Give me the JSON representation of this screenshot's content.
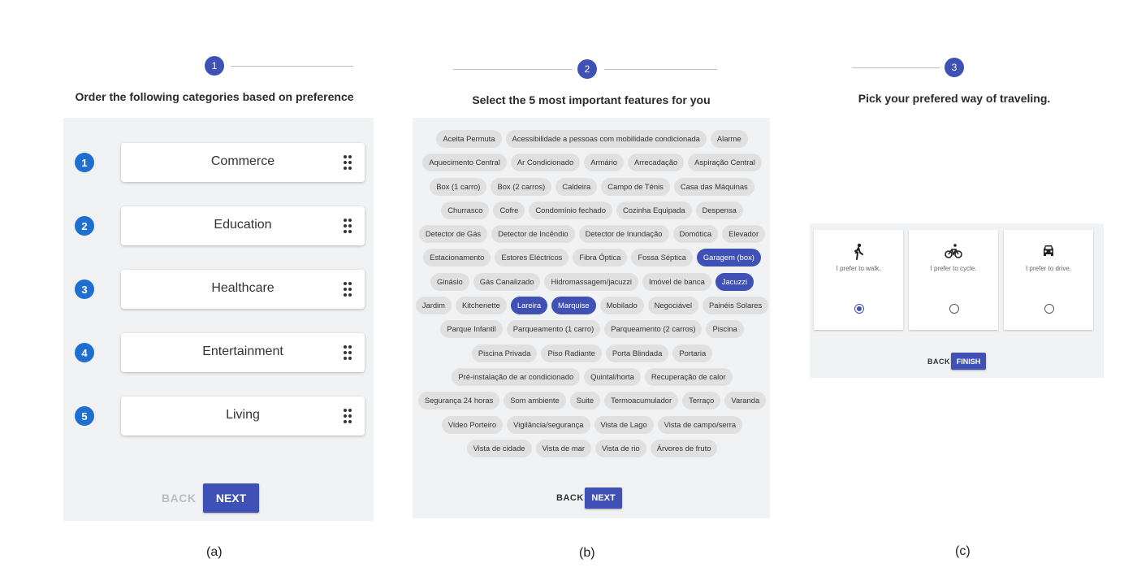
{
  "panel_a": {
    "step": "1",
    "heading": "Order the following categories based on preference",
    "categories": [
      {
        "rank": "1",
        "label": "Commerce"
      },
      {
        "rank": "2",
        "label": "Education"
      },
      {
        "rank": "3",
        "label": "Healthcare"
      },
      {
        "rank": "4",
        "label": "Entertainment"
      },
      {
        "rank": "5",
        "label": "Living"
      }
    ],
    "back_label": "BACK",
    "next_label": "NEXT"
  },
  "panel_b": {
    "step": "2",
    "heading": "Select the 5 most important features for you",
    "chip_rows": [
      [
        {
          "label": "Aceita Permuta",
          "selected": false
        },
        {
          "label": "Acessibilidade a pessoas com mobilidade condicionada",
          "selected": false
        },
        {
          "label": "Alarme",
          "selected": false
        }
      ],
      [
        {
          "label": "Aquecimento Central",
          "selected": false
        },
        {
          "label": "Ar Condicionado",
          "selected": false
        },
        {
          "label": "Armário",
          "selected": false
        },
        {
          "label": "Arrecadação",
          "selected": false
        },
        {
          "label": "Aspiração Central",
          "selected": false
        }
      ],
      [
        {
          "label": "Box (1 carro)",
          "selected": false
        },
        {
          "label": "Box (2 carros)",
          "selected": false
        },
        {
          "label": "Caldeira",
          "selected": false
        },
        {
          "label": "Campo de Ténis",
          "selected": false
        },
        {
          "label": "Casa das Máquinas",
          "selected": false
        }
      ],
      [
        {
          "label": "Churrasco",
          "selected": false
        },
        {
          "label": "Cofre",
          "selected": false
        },
        {
          "label": "Condomínio fechado",
          "selected": false
        },
        {
          "label": "Cozinha Equipada",
          "selected": false
        },
        {
          "label": "Despensa",
          "selected": false
        }
      ],
      [
        {
          "label": "Detector de Gás",
          "selected": false
        },
        {
          "label": "Detector de Incêndio",
          "selected": false
        },
        {
          "label": "Detector de Inundação",
          "selected": false
        },
        {
          "label": "Domótica",
          "selected": false
        },
        {
          "label": "Elevador",
          "selected": false
        }
      ],
      [
        {
          "label": "Estacionamento",
          "selected": false
        },
        {
          "label": "Estores Eléctricos",
          "selected": false
        },
        {
          "label": "Fibra Óptica",
          "selected": false
        },
        {
          "label": "Fossa Séptica",
          "selected": false
        },
        {
          "label": "Garagem (box)",
          "selected": true
        }
      ],
      [
        {
          "label": "Ginásio",
          "selected": false
        },
        {
          "label": "Gás Canalizado",
          "selected": false
        },
        {
          "label": "Hidromassagem/jacuzzi",
          "selected": false
        },
        {
          "label": "Imóvel de banca",
          "selected": false
        },
        {
          "label": "Jacuzzi",
          "selected": true
        }
      ],
      [
        {
          "label": "Jardim",
          "selected": false
        },
        {
          "label": "Kitchenette",
          "selected": false
        },
        {
          "label": "Lareira",
          "selected": true
        },
        {
          "label": "Marquise",
          "selected": true
        },
        {
          "label": "Mobilado",
          "selected": false
        },
        {
          "label": "Negociável",
          "selected": false
        },
        {
          "label": "Painéis Solares",
          "selected": false
        }
      ],
      [
        {
          "label": "Parque Infantil",
          "selected": false
        },
        {
          "label": "Parqueamento (1 carro)",
          "selected": false
        },
        {
          "label": "Parqueamento (2 carros)",
          "selected": false
        },
        {
          "label": "Piscina",
          "selected": false
        }
      ],
      [
        {
          "label": "Piscina Privada",
          "selected": false
        },
        {
          "label": "Piso Radiante",
          "selected": false
        },
        {
          "label": "Porta Blindada",
          "selected": false
        },
        {
          "label": "Portaria",
          "selected": false
        }
      ],
      [
        {
          "label": "Pré-instalação de ar condicionado",
          "selected": false
        },
        {
          "label": "Quintal/horta",
          "selected": false
        },
        {
          "label": "Recuperação de calor",
          "selected": false
        }
      ],
      [
        {
          "label": "Segurança 24 horas",
          "selected": false
        },
        {
          "label": "Som ambiente",
          "selected": false
        },
        {
          "label": "Suite",
          "selected": false
        },
        {
          "label": "Termoacumulador",
          "selected": false
        },
        {
          "label": "Terraço",
          "selected": false
        },
        {
          "label": "Varanda",
          "selected": false
        }
      ],
      [
        {
          "label": "Video Porteiro",
          "selected": false
        },
        {
          "label": "Vigilância/segurança",
          "selected": false
        },
        {
          "label": "Vista de Lago",
          "selected": false
        },
        {
          "label": "Vista de campo/serra",
          "selected": false
        }
      ],
      [
        {
          "label": "Vista de cidade",
          "selected": false
        },
        {
          "label": "Vista de mar",
          "selected": false
        },
        {
          "label": "Vista de rio",
          "selected": false
        },
        {
          "label": "Árvores de fruto",
          "selected": false
        }
      ]
    ],
    "back_label": "BACK",
    "next_label": "NEXT"
  },
  "panel_c": {
    "step": "3",
    "heading": "Pick your prefered way of traveling.",
    "options": [
      {
        "icon": "walk-icon",
        "label": "I prefer to walk.",
        "selected": true
      },
      {
        "icon": "bicycle-icon",
        "label": "I prefer to cycle.",
        "selected": false
      },
      {
        "icon": "car-icon",
        "label": "I prefer to drive.",
        "selected": false
      }
    ],
    "back_label": "BACK",
    "finish_label": "FINISH"
  },
  "captions": [
    "(a)",
    "(b)",
    "(c)"
  ],
  "colors": {
    "accent": "#3f51b5",
    "rank_badge": "#1f6fd1",
    "panel_bg": "#f1f2f4",
    "chip_bg": "#e0e0e0"
  }
}
